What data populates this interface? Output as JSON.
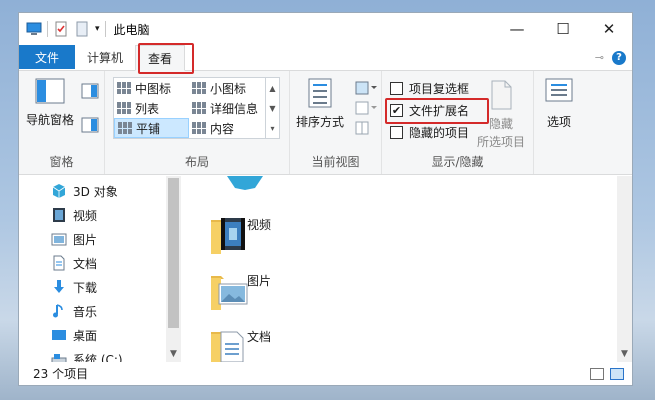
{
  "window": {
    "title": "此电脑",
    "controls": {
      "minimize": "—",
      "maximize": "☐",
      "close": "✕"
    }
  },
  "ribbon_tabs": {
    "file": "文件",
    "computer": "计算机",
    "view": "查看"
  },
  "ribbon": {
    "panes": {
      "nav_pane": "导航窗格",
      "label": "窗格"
    },
    "layout": {
      "items": [
        "中图标",
        "小图标",
        "列表",
        "详细信息",
        "平铺",
        "内容"
      ],
      "selected": "平铺",
      "label": "布局"
    },
    "current_view": {
      "sort": "排序方式",
      "label": "当前视图"
    },
    "show_hide": {
      "item_checkboxes": "项目复选框",
      "file_extensions": "文件扩展名",
      "hidden_items": "隐藏的项目",
      "hide_selected": "隐藏",
      "hide_selected_sub": "所选项目",
      "label": "显示/隐藏",
      "file_extensions_checked": true
    },
    "options": {
      "label": "选项"
    }
  },
  "nav_items": [
    "3D 对象",
    "视频",
    "图片",
    "文档",
    "下载",
    "音乐",
    "桌面",
    "系统 (C:)"
  ],
  "content_items": [
    "视频",
    "图片",
    "文档"
  ],
  "status": {
    "item_count": "23 个项目"
  },
  "colors": {
    "accent": "#1979ca",
    "highlight_box": "#d42a2a",
    "selected": "#cce8ff",
    "folder": "#f6d065"
  }
}
